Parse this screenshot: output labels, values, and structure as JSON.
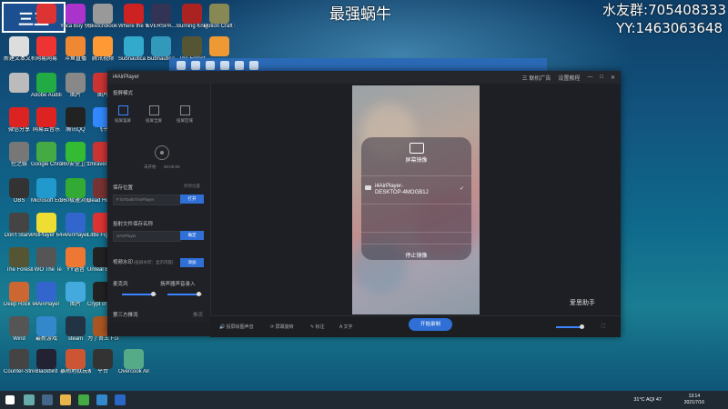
{
  "overlay": {
    "title": "最强蜗牛",
    "qq_group": "水友群:705408333",
    "yy": "YY:1463063648",
    "logo": "三五"
  },
  "desktop_icons": [
    {
      "label": "",
      "color": "#d33"
    },
    {
      "label": "Yoca Boy 快播官网",
      "color": "#a3c"
    },
    {
      "label": "SketchBook",
      "color": "#999"
    },
    {
      "label": "Where the Water Ta...",
      "color": "#c22"
    },
    {
      "label": "EVERSPA...",
      "color": "#335"
    },
    {
      "label": "Burning Knight",
      "color": "#a22"
    },
    {
      "label": "Potion Craft Demo",
      "color": "#885"
    },
    {
      "label": "新建文本文档 (2)",
      "color": "#ddd"
    },
    {
      "label": "网易网易",
      "color": "#e33"
    },
    {
      "label": "斗鱼直播",
      "color": "#e83"
    },
    {
      "label": "腾讯视频",
      "color": "#f93"
    },
    {
      "label": "Subnautica Below Zero",
      "color": "#3ac"
    },
    {
      "label": "Subnautica",
      "color": "#39b"
    },
    {
      "label": "The Forest",
      "color": "#553"
    },
    {
      "label": "",
      "color": "#e93"
    },
    {
      "label": "",
      "color": "#bbb"
    },
    {
      "label": "Adobe Audition 3.0",
      "color": "#2a4"
    },
    {
      "label": "图片",
      "color": "#888"
    },
    {
      "label": "图片",
      "color": "#c33"
    },
    {
      "label": "微信分享",
      "color": "#d22"
    },
    {
      "label": "网易云音乐",
      "color": "#d22"
    },
    {
      "label": "腾讯QQ",
      "color": "#222"
    },
    {
      "label": "飞书",
      "color": "#38f"
    },
    {
      "label": "控之娱",
      "color": "#777"
    },
    {
      "label": "Google Chrome",
      "color": "#4a4"
    },
    {
      "label": "360安全卫士",
      "color": "#3b3"
    },
    {
      "label": "Unravel Two",
      "color": "#c33"
    },
    {
      "label": "OBS",
      "color": "#333"
    },
    {
      "label": "Microsoft Edge",
      "color": "#29c"
    },
    {
      "label": "360极速浏览器",
      "color": "#3a3"
    },
    {
      "label": "Dead Hunting",
      "color": "#733"
    },
    {
      "label": "Don't Starve",
      "color": "#444"
    },
    {
      "label": "PotPlayer 64 bit",
      "color": "#ed3"
    },
    {
      "label": "i4AirPlayer",
      "color": "#36c"
    },
    {
      "label": "Little Fighter 2",
      "color": "#d33"
    },
    {
      "label": "The Forest",
      "color": "#553"
    },
    {
      "label": "TWO The Tempes...",
      "color": "#555"
    },
    {
      "label": "YY语音",
      "color": "#e73"
    },
    {
      "label": "Unreal Engine",
      "color": "#222"
    },
    {
      "label": "Deep Rock Galactic",
      "color": "#c63"
    },
    {
      "label": "i4AirPlayer",
      "color": "#36c"
    },
    {
      "label": "图片",
      "color": "#4ad"
    },
    {
      "label": "Crypt of the NecroDancer",
      "color": "#222"
    },
    {
      "label": "Wind",
      "color": "#555"
    },
    {
      "label": "最新游戏",
      "color": "#38c"
    },
    {
      "label": "steam",
      "color": "#234"
    },
    {
      "label": "为了吾王 For The King",
      "color": "#a52"
    },
    {
      "label": "Counter-Strike Global Off...",
      "color": "#444"
    },
    {
      "label": "Blackbird",
      "color": "#223"
    },
    {
      "label": "暴雨地狱玩家",
      "color": "#c53"
    },
    {
      "label": "平台",
      "color": "#333"
    },
    {
      "label": "Overcook All You Ca...",
      "color": "#5a8"
    }
  ],
  "app": {
    "title": "i4AirPlayer",
    "actions": [
      "三 联机广告",
      "设置教程",
      "—",
      "□",
      "✕"
    ],
    "mirror_mode_heading": "投屏模式",
    "modes": [
      "投屏竖屏",
      "投屏全屏",
      "投屏区域"
    ],
    "rec_time": "00:00:00",
    "rec_status": "未开始",
    "save_location_heading": "保存位置",
    "save_location_change": "修改位置",
    "save_path": "F:\\i4Tools7\\AirPlayer",
    "open_button": "打开",
    "device_name_heading": "投射文件保存名称",
    "device_name_value": "i4AirPlayer",
    "confirm_button": "确定",
    "watermark_heading": "视频水印",
    "watermark_placeholder": "(投屏水印：显示内容)",
    "add_button": "添加",
    "mic_label": "麦克风",
    "speaker_label": "扬声器声音录入",
    "third_party_heading": "第三方推流",
    "third_party_action": "推流",
    "third_party_placeholder": "投屏 / 推流地址 address",
    "mirror_panel_title": "屏幕镜像",
    "device_line1": "i4AirPlayer-",
    "device_line2": "DESKTOP-4MOGB1J",
    "device_check": "✓",
    "stop_mirror": "停止镜像",
    "bottom": {
      "item1": "投屏绘图声音",
      "item2": "屏幕旋转",
      "item3": "标注",
      "item4": "文字",
      "start_button": "开始录制"
    },
    "brand_watermark": "爱思助手"
  },
  "taskbar": {
    "weather": "31°C AQI 47",
    "time": "13:14",
    "date": "2021/7/16"
  }
}
